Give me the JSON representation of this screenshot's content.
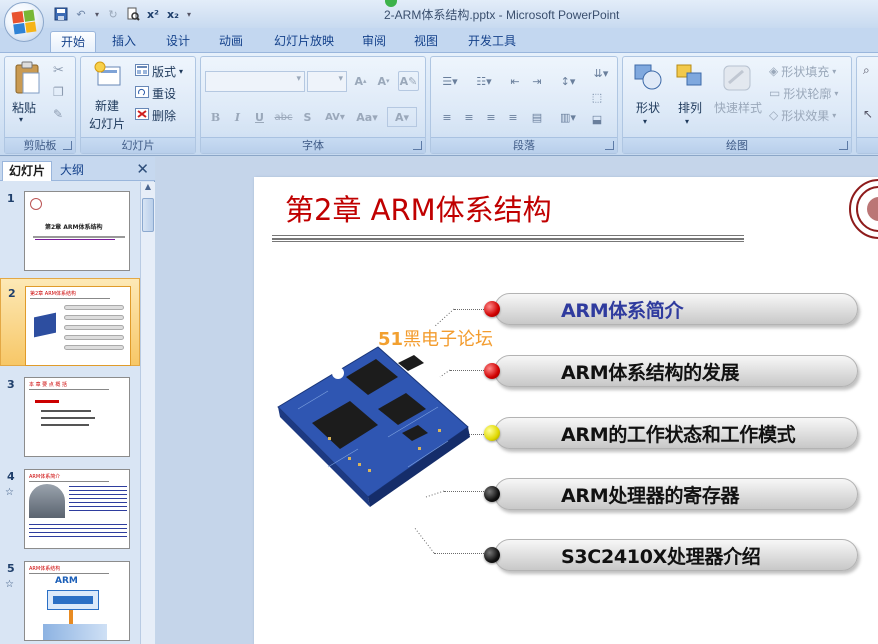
{
  "window": {
    "title": "2-ARM体系结构.pptx - Microsoft PowerPoint"
  },
  "tabs": [
    "开始",
    "插入",
    "设计",
    "动画",
    "幻灯片放映",
    "审阅",
    "视图",
    "开发工具"
  ],
  "active_tab": "开始",
  "ribbon": {
    "clipboard": {
      "label": "剪贴板",
      "paste": "粘贴"
    },
    "slides": {
      "label": "幻灯片",
      "new_slide": "新建\n幻灯片",
      "new_slide_1": "新建",
      "new_slide_2": "幻灯片",
      "layout": "版式",
      "reset": "重设",
      "delete": "删除"
    },
    "font": {
      "label": "字体"
    },
    "paragraph": {
      "label": "段落"
    },
    "drawing": {
      "label": "绘图",
      "shapes": "形状",
      "arrange": "排列",
      "quick_styles": "快速样式",
      "shape_fill": "形状填充",
      "shape_outline": "形状轮廓",
      "shape_effects": "形状效果"
    }
  },
  "left_pane": {
    "tab_slides": "幻灯片",
    "tab_outline": "大纲",
    "thumbnails": [
      {
        "num": "1",
        "text": "第2章 ARM体系结构",
        "star": false
      },
      {
        "num": "2",
        "text": "第2章  ARM体系结构",
        "star": false,
        "selected": true
      },
      {
        "num": "3",
        "text": "本 章 要 点 概 括",
        "star": false
      },
      {
        "num": "4",
        "text": "ARM体系简介",
        "star": true
      },
      {
        "num": "5",
        "text": "ARM体系结构",
        "star": true
      }
    ]
  },
  "slide": {
    "title": "第2章  ARM体系结构",
    "watermark": "51黑电子论坛",
    "watermark_num": "51",
    "watermark_rest": "黑电子论坛",
    "menu_items": [
      {
        "text": "ARM体系简介",
        "bullet_color": "#e01010"
      },
      {
        "text": "ARM体系结构的发展",
        "bullet_color": "#e01010"
      },
      {
        "text": "ARM的工作状态和工作模式",
        "bullet_color": "#e8e000"
      },
      {
        "text": "ARM处理器的寄存器",
        "bullet_color": "#111111"
      },
      {
        "text": "S3C2410X处理器介绍",
        "bullet_color": "#111111"
      }
    ]
  }
}
